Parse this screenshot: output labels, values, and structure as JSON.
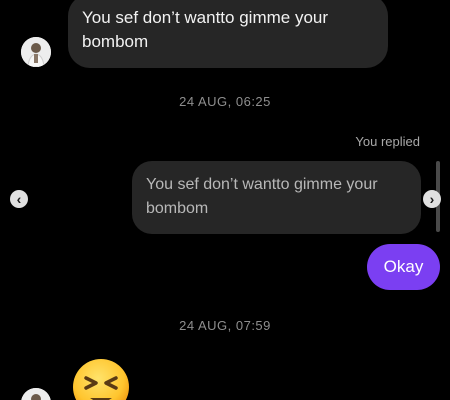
{
  "messages": [
    {
      "id": "msg1",
      "sender": "other",
      "text": "You sef don’t wantto gimme your bombom"
    },
    {
      "id": "ts1",
      "type": "timestamp",
      "text": "24 AUG, 06:25"
    },
    {
      "id": "reply",
      "sender": "me",
      "replied_label": "You replied",
      "quoted_text": "You sef don’t wantto gimme your bombom",
      "text": "Okay"
    },
    {
      "id": "ts2",
      "type": "timestamp",
      "text": "24 AUG, 07:59"
    },
    {
      "id": "emoji",
      "sender": "other",
      "emoji_icon": "tightly-closed-eyes-face-icon"
    }
  ],
  "icons": {
    "nav_left": "chevron-left-icon",
    "nav_right": "chevron-right-icon"
  },
  "colors": {
    "background": "#000000",
    "incoming_bubble": "#262626",
    "outgoing_bubble": "#7b3ff2",
    "timestamp": "#8e8e8e"
  }
}
